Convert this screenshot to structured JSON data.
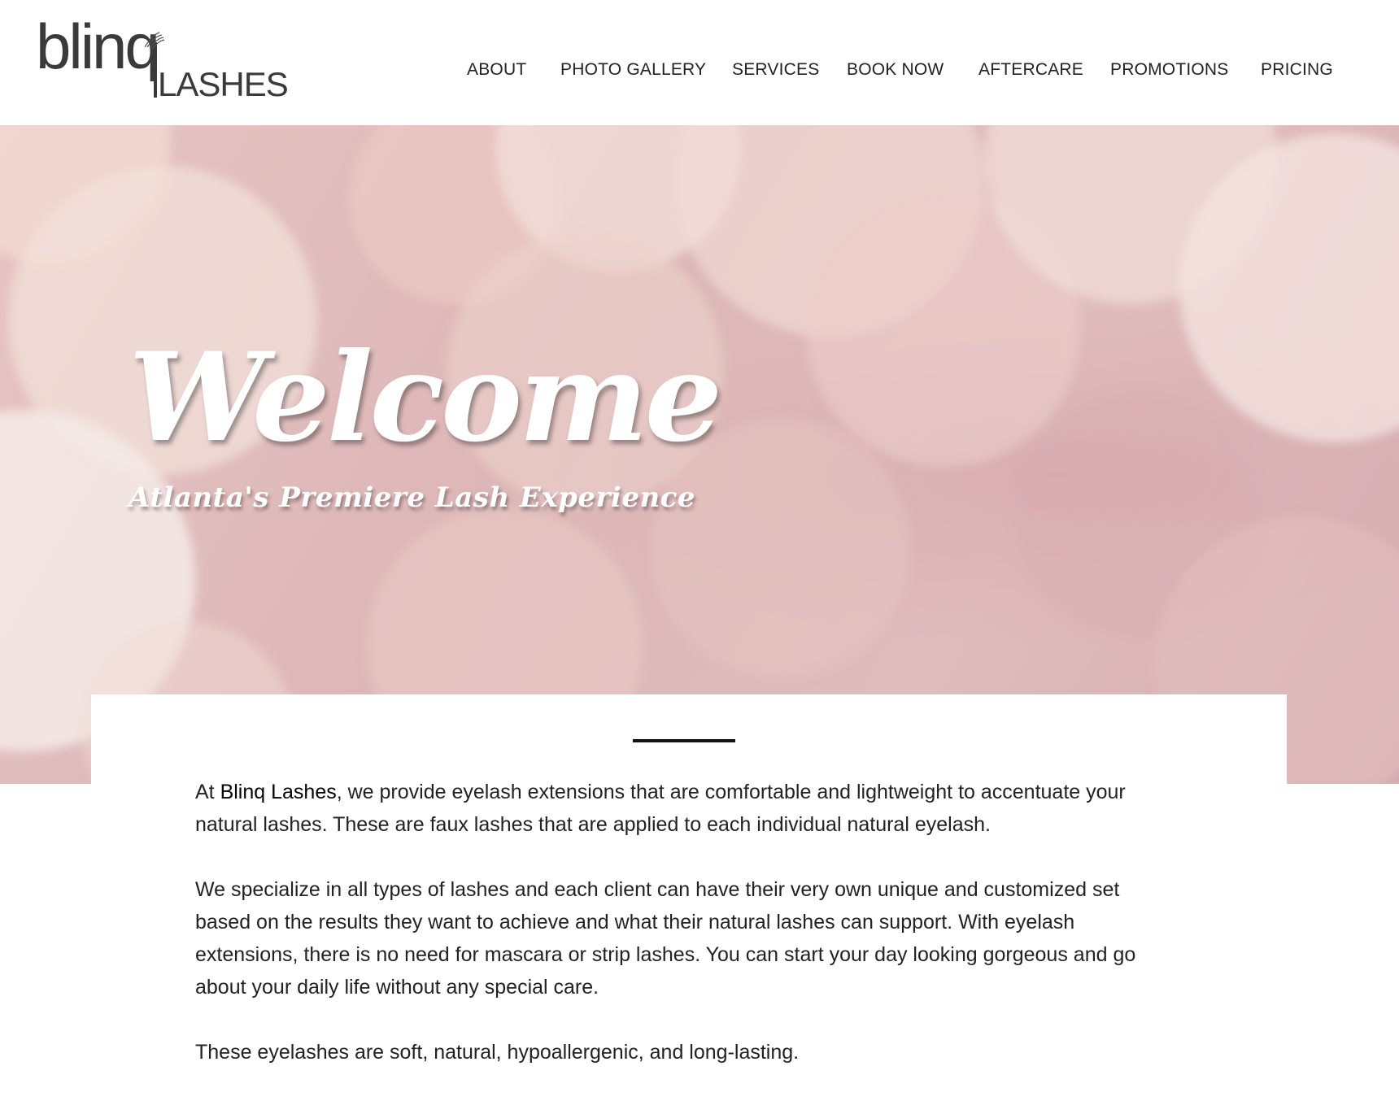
{
  "brand": {
    "logo_main": "blinq",
    "logo_sub": "LASHES"
  },
  "nav": {
    "items": [
      {
        "label": "ABOUT"
      },
      {
        "label": "PHOTO GALLERY"
      },
      {
        "label": "SERVICES"
      },
      {
        "label": "BOOK NOW"
      },
      {
        "label": "AFTERCARE"
      },
      {
        "label": "PROMOTIONS"
      },
      {
        "label": "PRICING"
      }
    ]
  },
  "hero": {
    "title": "Welcome",
    "tagline": "Atlanta's Premiere Lash Experience"
  },
  "intro": {
    "p1_prefix": "At ",
    "p1_brand": "Blinq Lashes",
    "p1_rest": ", we provide eyelash extensions that are comfortable and lightweight to accentuate your natural lashes. These are faux lashes that are applied to each individual natural eyelash.",
    "p2": "We specialize in all types of lashes and each client can have their very own unique and customized set based on the results they want to achieve and what their natural lashes can support. With eyelash extensions, there is no need for mascara or strip lashes. You can start your day looking gorgeous and go about your daily life without any special care.",
    "p3": "These eyelashes are soft, natural, hypoallergenic, and long-lasting."
  },
  "colors": {
    "hero_pink": "#e0bcbd",
    "text": "#222222",
    "divider": "#111111"
  }
}
